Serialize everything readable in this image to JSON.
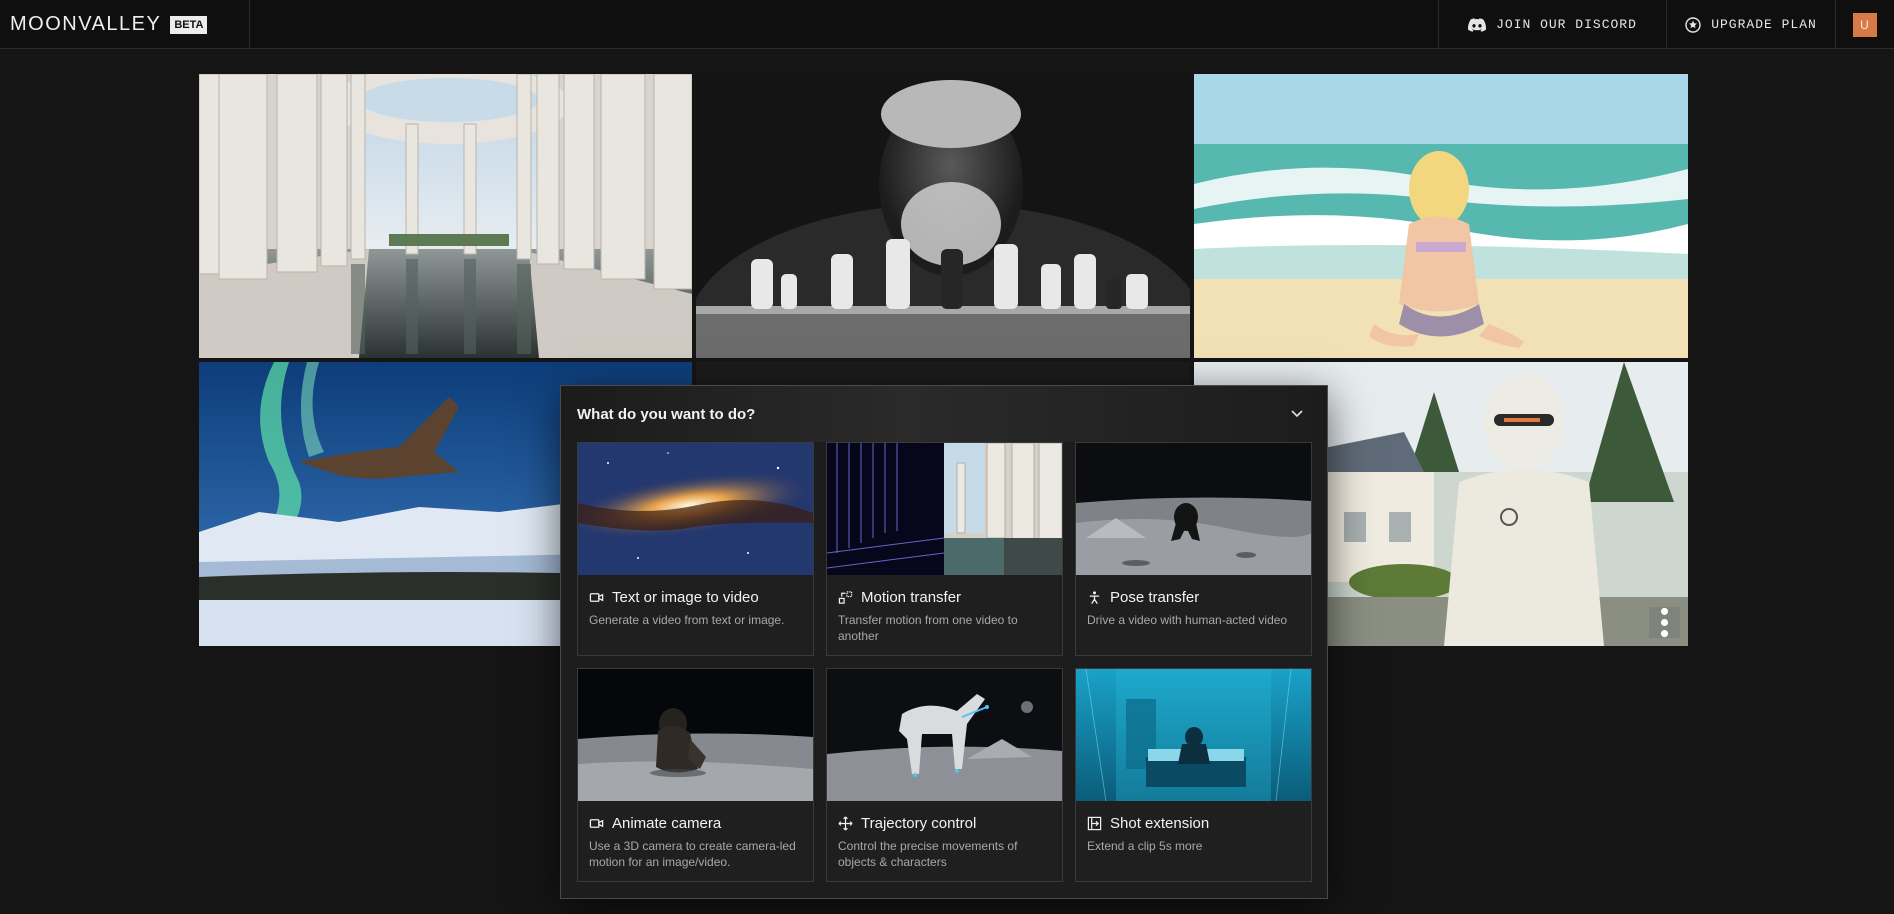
{
  "header": {
    "brand": "MOONVALLEY",
    "badge": "BETA",
    "discord_label": "JOIN OUR DISCORD",
    "upgrade_label": "UPGRADE PLAN",
    "avatar_initial": "U"
  },
  "colors": {
    "background": "#151515",
    "topbar": "#0f0f0f",
    "avatar": "#d77a45",
    "card_bg": "#1f1f1f"
  },
  "panel": {
    "title": "What do you want to do?",
    "cards": [
      {
        "title": "Text or image to video",
        "desc": "Generate a video from text or image.",
        "icon": "video-camera-icon"
      },
      {
        "title": "Motion transfer",
        "desc": "Transfer motion from one video to another",
        "icon": "motion-transfer-icon"
      },
      {
        "title": "Pose transfer",
        "desc": "Drive a video with human-acted video",
        "icon": "person-pose-icon"
      },
      {
        "title": "Animate camera",
        "desc": "Use a 3D camera to create camera-led motion for an image/video.",
        "icon": "video-camera-icon"
      },
      {
        "title": "Trajectory control",
        "desc": "Control the precise movements of objects & characters",
        "icon": "move-arrows-icon"
      },
      {
        "title": "Shot extension",
        "desc": "Extend a clip 5s more",
        "icon": "shot-extension-icon"
      }
    ]
  }
}
